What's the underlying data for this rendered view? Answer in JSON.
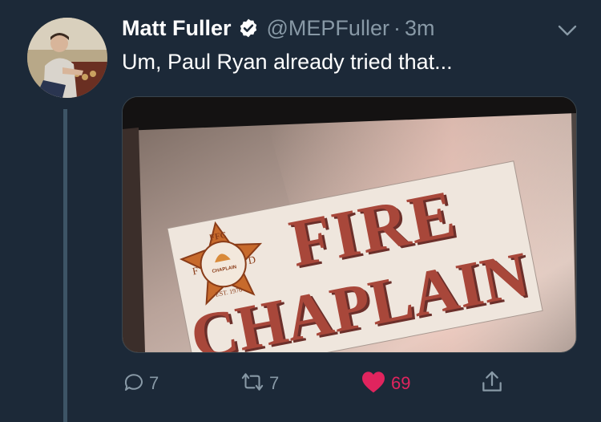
{
  "tweet": {
    "avatar_icon": "profile-photo",
    "display_name": "Matt Fuller",
    "verified_icon": "verified-badge-icon",
    "handle": "@MEPFuller",
    "separator": "·",
    "timestamp": "3m",
    "menu_icon": "chevron-down-icon",
    "text": "Um, Paul Ryan already tried that...",
    "media": {
      "sign_line1": "FIRE",
      "sign_line2": "CHAPLAIN",
      "logo_top": "FFC",
      "logo_left": "F",
      "logo_right": "D",
      "logo_center": "CHAPLAIN",
      "logo_bottom": "EST. 1976"
    }
  },
  "actions": {
    "reply": {
      "icon": "reply-icon",
      "count": "7"
    },
    "retweet": {
      "icon": "retweet-icon",
      "count": "7"
    },
    "like": {
      "icon": "heart-icon",
      "count": "69",
      "color": "#e0245e"
    },
    "share": {
      "icon": "share-icon"
    }
  },
  "colors": {
    "background": "#1c2938",
    "secondary_text": "#8899a6",
    "thread_line": "#3d5466",
    "like": "#e0245e"
  }
}
